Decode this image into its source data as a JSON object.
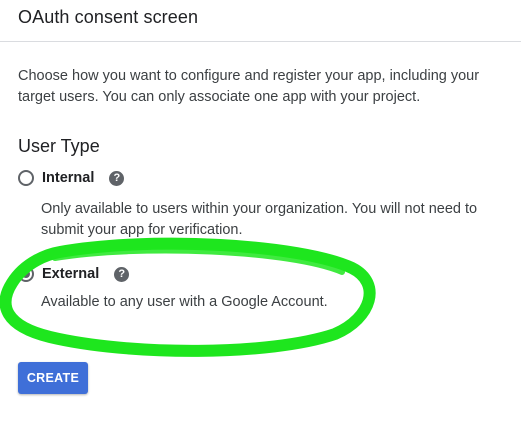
{
  "header": {
    "title": "OAuth consent screen"
  },
  "intro": {
    "text": "Choose how you want to configure and register your app, including your target users. You can only associate one app with your project."
  },
  "user_type": {
    "title": "User Type",
    "options": [
      {
        "label": "Internal",
        "selected": false,
        "help_icon": "?",
        "description": "Only available to users within your organization. You will not need to submit your app for verification."
      },
      {
        "label": "External",
        "selected": true,
        "help_icon": "?",
        "description": "Available to any user with a Google Account."
      }
    ]
  },
  "actions": {
    "create_label": "CREATE"
  },
  "colors": {
    "primary_button": "#3f6fd8",
    "annotation": "#1ee61e",
    "radio": "#5f6368"
  }
}
